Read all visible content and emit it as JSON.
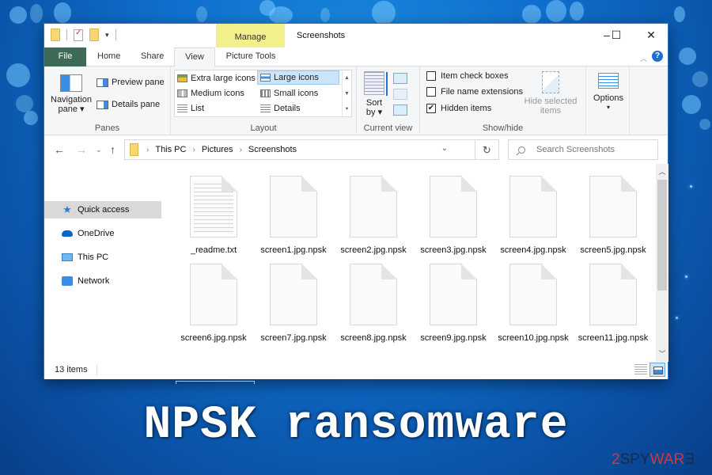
{
  "window": {
    "title": "Screenshots",
    "contextual_tab": "Manage",
    "controls": {
      "minimize": "–",
      "maximize": "☐",
      "close": "✕"
    }
  },
  "ribbon_tabs": [
    {
      "label": "File",
      "active": false
    },
    {
      "label": "Home",
      "active": false
    },
    {
      "label": "Share",
      "active": false
    },
    {
      "label": "View",
      "active": true
    },
    {
      "label": "Picture Tools",
      "active": false
    }
  ],
  "ribbon": {
    "panes": {
      "label": "Panes",
      "navigation_pane": "Navigation pane",
      "navigation_pane_line1": "Navigation",
      "navigation_pane_line2": "pane ▾",
      "preview_pane": "Preview pane",
      "details_pane": "Details pane"
    },
    "layout": {
      "label": "Layout",
      "options": [
        {
          "label": "Extra large icons",
          "icon": "extra-large-icons-icon",
          "selected": false
        },
        {
          "label": "Large icons",
          "icon": "large-icons-icon",
          "selected": true
        },
        {
          "label": "Medium icons",
          "icon": "medium-icons-icon",
          "selected": false
        },
        {
          "label": "Small icons",
          "icon": "small-icons-icon",
          "selected": false
        },
        {
          "label": "List",
          "icon": "list-icon",
          "selected": false
        },
        {
          "label": "Details",
          "icon": "details-icon",
          "selected": false
        }
      ]
    },
    "current_view": {
      "label": "Current view",
      "sort_by_line1": "Sort",
      "sort_by_line2": "by ▾"
    },
    "show_hide": {
      "label": "Show/hide",
      "checkboxes": [
        {
          "label": "Item check boxes",
          "checked": false
        },
        {
          "label": "File name extensions",
          "checked": false
        },
        {
          "label": "Hidden items",
          "checked": true
        }
      ],
      "hide_selected_line1": "Hide selected",
      "hide_selected_line2": "items"
    },
    "options": {
      "label": "Options",
      "arrow": "▾"
    }
  },
  "address_bar": {
    "breadcrumb": [
      "This PC",
      "Pictures",
      "Screenshots"
    ],
    "search_placeholder": "Search Screenshots"
  },
  "sidebar": {
    "items": [
      {
        "label": "Quick access",
        "icon": "star-icon",
        "active": true
      },
      {
        "label": "OneDrive",
        "icon": "cloud-icon",
        "active": false
      },
      {
        "label": "This PC",
        "icon": "computer-icon",
        "active": false
      },
      {
        "label": "Network",
        "icon": "network-icon",
        "active": false
      }
    ]
  },
  "files": [
    {
      "name": "_readme.txt",
      "type": "txt"
    },
    {
      "name": "screen1.jpg.npsk",
      "type": "blank"
    },
    {
      "name": "screen2.jpg.npsk",
      "type": "blank"
    },
    {
      "name": "screen3.jpg.npsk",
      "type": "blank"
    },
    {
      "name": "screen4.jpg.npsk",
      "type": "blank"
    },
    {
      "name": "screen5.jpg.npsk",
      "type": "blank"
    },
    {
      "name": "screen6.jpg.npsk",
      "type": "blank"
    },
    {
      "name": "screen7.jpg.npsk",
      "type": "blank"
    },
    {
      "name": "screen8.jpg.npsk",
      "type": "blank"
    },
    {
      "name": "screen9.jpg.npsk",
      "type": "blank"
    },
    {
      "name": "screen10.jpg.npsk",
      "type": "blank"
    },
    {
      "name": "screen11.jpg.npsk",
      "type": "blank"
    }
  ],
  "status_bar": {
    "item_count": "13 items"
  },
  "caption": {
    "text": "NPSK ransomware"
  },
  "watermark": {
    "part1": "2",
    "part2": "SPY",
    "part3": "WAR",
    "part4": "Ǝ"
  },
  "colors": {
    "file_tab": "#3d6b57",
    "manage_tab": "#f1f08c",
    "accent_blue": "#1e6fd0",
    "selected_bg": "#cce4f7",
    "background_blue": "#0f6fcc",
    "watermark_red": "#d9333f"
  }
}
